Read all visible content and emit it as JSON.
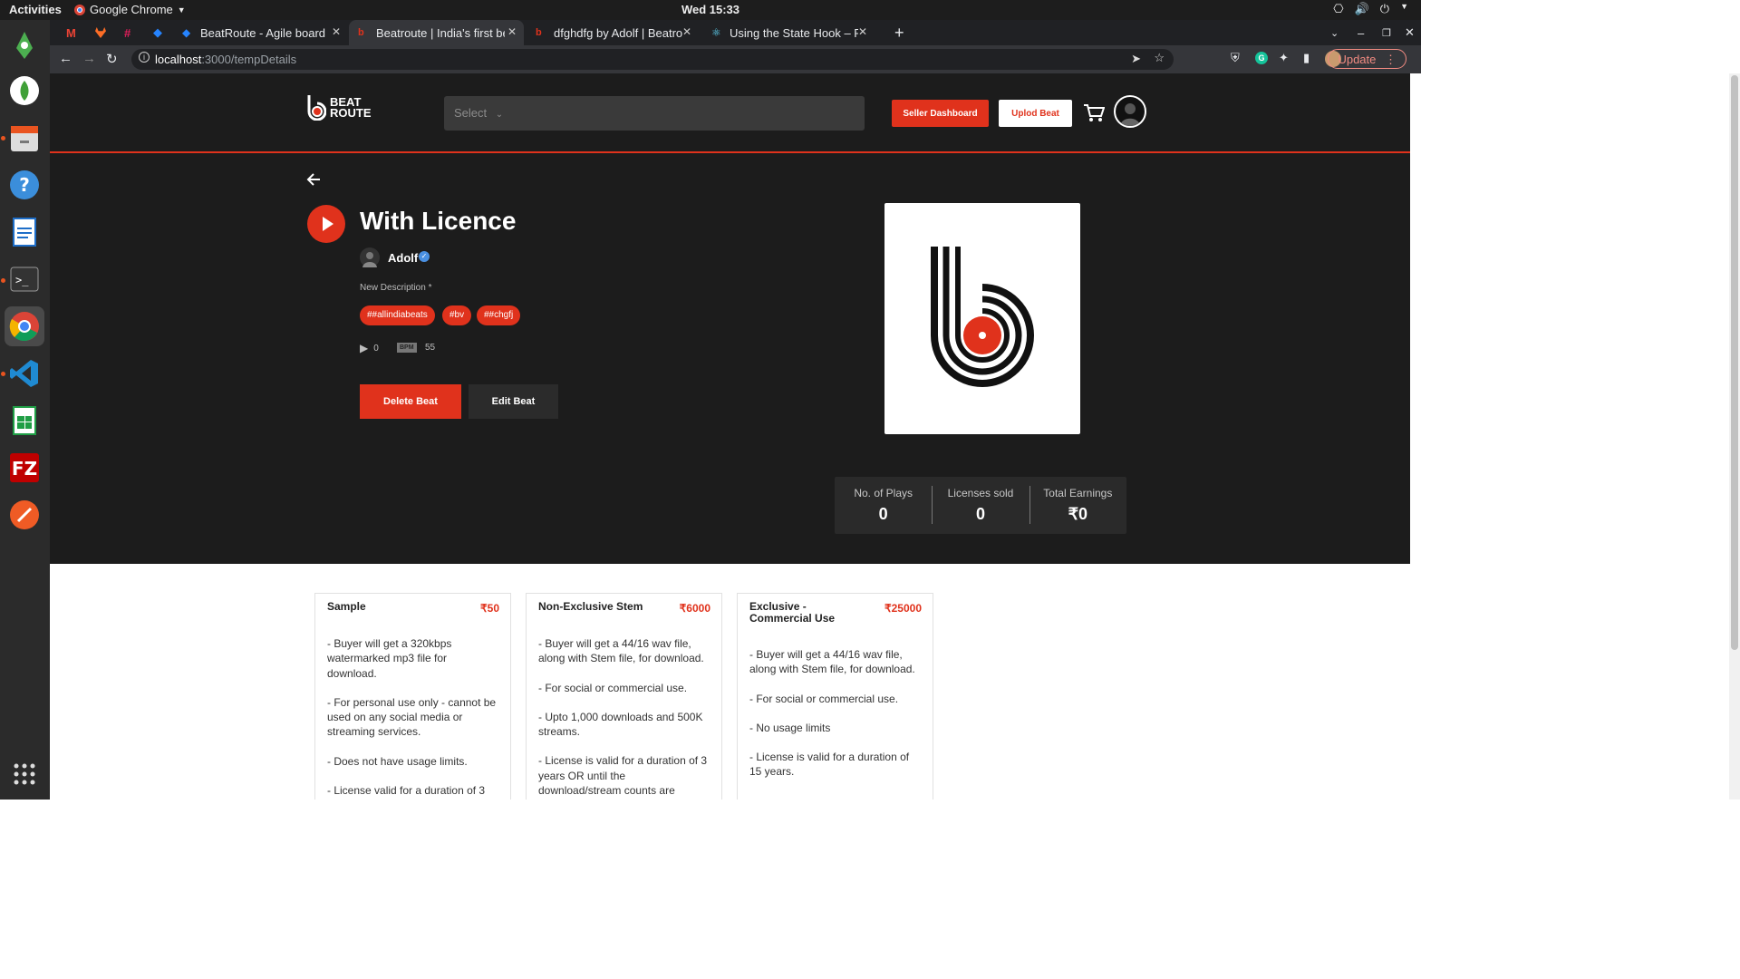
{
  "os": {
    "activities": "Activities",
    "app_name": "Google Chrome",
    "clock": "Wed 15:33"
  },
  "tabs": [
    {
      "label": "BeatRoute - Agile board -",
      "active": false
    },
    {
      "label": "Beatroute | India's first be",
      "active": true
    },
    {
      "label": "dfghdfg by Adolf | Beatro",
      "active": false
    },
    {
      "label": "Using the State Hook – Re",
      "active": false
    }
  ],
  "omnibox": {
    "host": "localhost",
    "path": ":3000/tempDetails",
    "update_label": "Update"
  },
  "header": {
    "logo_line1": "BEAT",
    "logo_line2": "ROUTE",
    "search_placeholder": "Select",
    "seller_label": "Seller Dashboard",
    "upload_label": "Uplod Beat"
  },
  "beat": {
    "title": "With Licence",
    "artist": "Adolf",
    "description": "New Description *",
    "tags": [
      "##allindiabeats",
      "#bv",
      "##chgfj"
    ],
    "play_count": "0",
    "bpm_label": "BPM",
    "bpm": "55",
    "delete_label": "Delete Beat",
    "edit_label": "Edit Beat"
  },
  "stats": [
    {
      "label": "No. of Plays",
      "value": "0"
    },
    {
      "label": "Licenses sold",
      "value": "0"
    },
    {
      "label": "Total Earnings",
      "value": "₹0"
    }
  ],
  "licenses": [
    {
      "title": "Sample",
      "price": "₹50",
      "items": [
        "- Buyer will get a 320kbps watermarked mp3 file for download.",
        "- For personal use only - cannot be used on any social media or streaming services.",
        "- Does not have usage limits.",
        "- License valid for a duration of 3"
      ]
    },
    {
      "title": "Non-Exclusive Stem",
      "price": "₹6000",
      "items": [
        "- Buyer will get a 44/16 wav file, along with Stem file, for download.",
        "- For social or commercial use.",
        "- Upto 1,000 downloads and 500K streams.",
        "- License is valid for a duration of 3 years OR until the download/stream counts are"
      ]
    },
    {
      "title": "Exclusive - Commercial Use",
      "price": "₹25000",
      "items": [
        "- Buyer will get a 44/16 wav file, along with Stem file, for download.",
        "- For social or commercial use.",
        "- No usage limits",
        "- License is valid for a duration of 15 years."
      ]
    }
  ],
  "colors": {
    "brand": "#e0321c",
    "hero_bg": "#1c1c1c"
  }
}
